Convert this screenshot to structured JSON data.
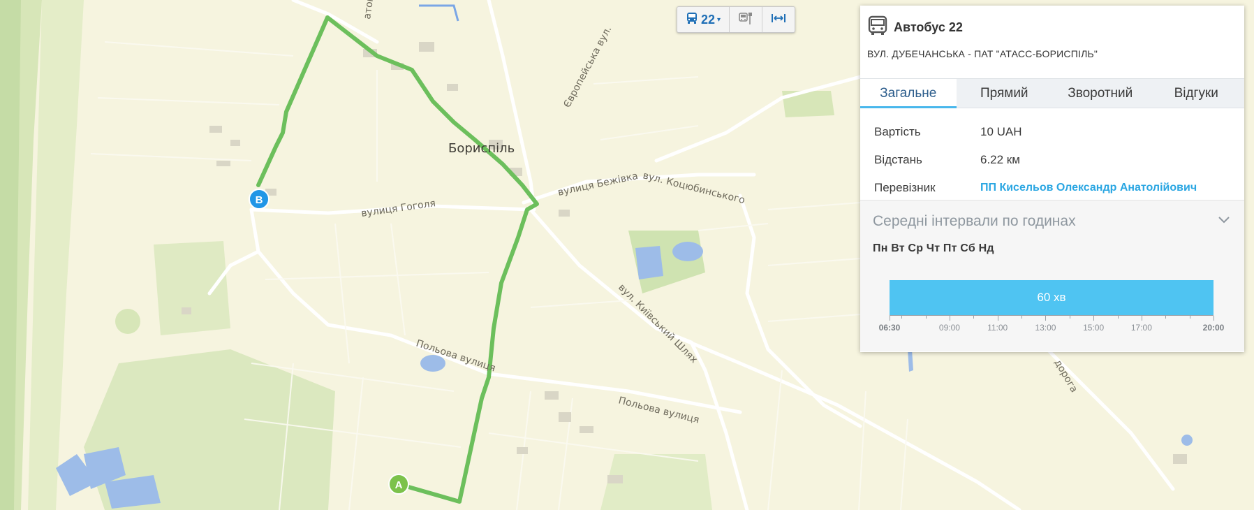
{
  "map": {
    "city_label": "Бориспіль",
    "street_labels": [
      "вулиця Гоголя",
      "вулиця Бежівка",
      "вул. Коцюбинського",
      "вул. Київський Шлях",
      "Польова вулиця",
      "Польова вулиця",
      "Європейська вул.",
      "дорога",
      "атого"
    ],
    "marker_start": "A",
    "marker_end": "B",
    "route_color": "#6cbf5c"
  },
  "controls": {
    "route_number": "22",
    "bus_icon": "bus-icon",
    "stops_icon": "bus-stop-icon",
    "fit_icon": "fit-bounds-icon"
  },
  "panel": {
    "title": "Автобус 22",
    "subtitle": "ВУЛ. ДУБЕЧАНСЬКА - ПАТ \"АТАСС-БОРИСПІЛЬ\"",
    "tabs": [
      "Загальне",
      "Прямий",
      "Зворотний",
      "Відгуки"
    ],
    "active_tab": "Загальне",
    "info": [
      {
        "label": "Вартість",
        "value": "10 UAH"
      },
      {
        "label": "Відстань",
        "value": "6.22 км"
      },
      {
        "label": "Перевізник",
        "value": "ПП Кисельов Олександр Анатолійович"
      }
    ],
    "intervals_title": "Середні інтервали по годинах",
    "days": "Пн Вт Ср Чт Пт Сб Нд",
    "interval_value": "60 хв",
    "axis_labels": [
      "06:30",
      "09:00",
      "11:00",
      "13:00",
      "15:00",
      "17:00",
      "20:00"
    ],
    "accent_color": "#4fc4f2"
  }
}
